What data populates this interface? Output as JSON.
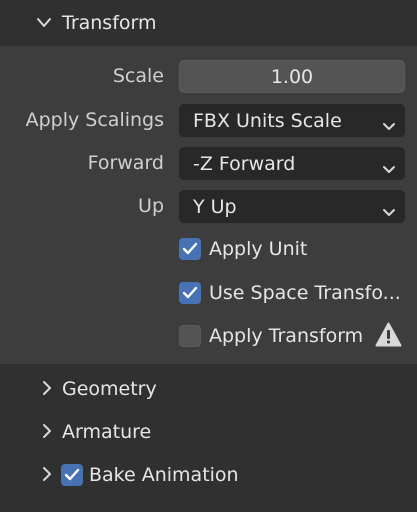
{
  "transform": {
    "title": "Transform",
    "scale_label": "Scale",
    "scale_value": "1.00",
    "apply_scalings_label": "Apply Scalings",
    "apply_scalings_value": "FBX Units Scale",
    "forward_label": "Forward",
    "forward_value": "-Z Forward",
    "up_label": "Up",
    "up_value": "Y Up",
    "apply_unit": {
      "label": "Apply Unit",
      "checked": true
    },
    "use_space_transform": {
      "label": "Use Space Transfo...",
      "checked": true
    },
    "apply_transform": {
      "label": "Apply Transform",
      "checked": false,
      "icon": "warning-icon"
    }
  },
  "sections": {
    "geometry": {
      "title": "Geometry",
      "expanded": false
    },
    "armature": {
      "title": "Armature",
      "expanded": false
    },
    "bake_animation": {
      "title": "Bake Animation",
      "expanded": false,
      "checked": true
    }
  },
  "colors": {
    "panel_bg": "#3d3d3d",
    "window_bg": "#303030",
    "accent": "#4772b3",
    "field_bg": "#282828",
    "number_bg": "#545454"
  }
}
